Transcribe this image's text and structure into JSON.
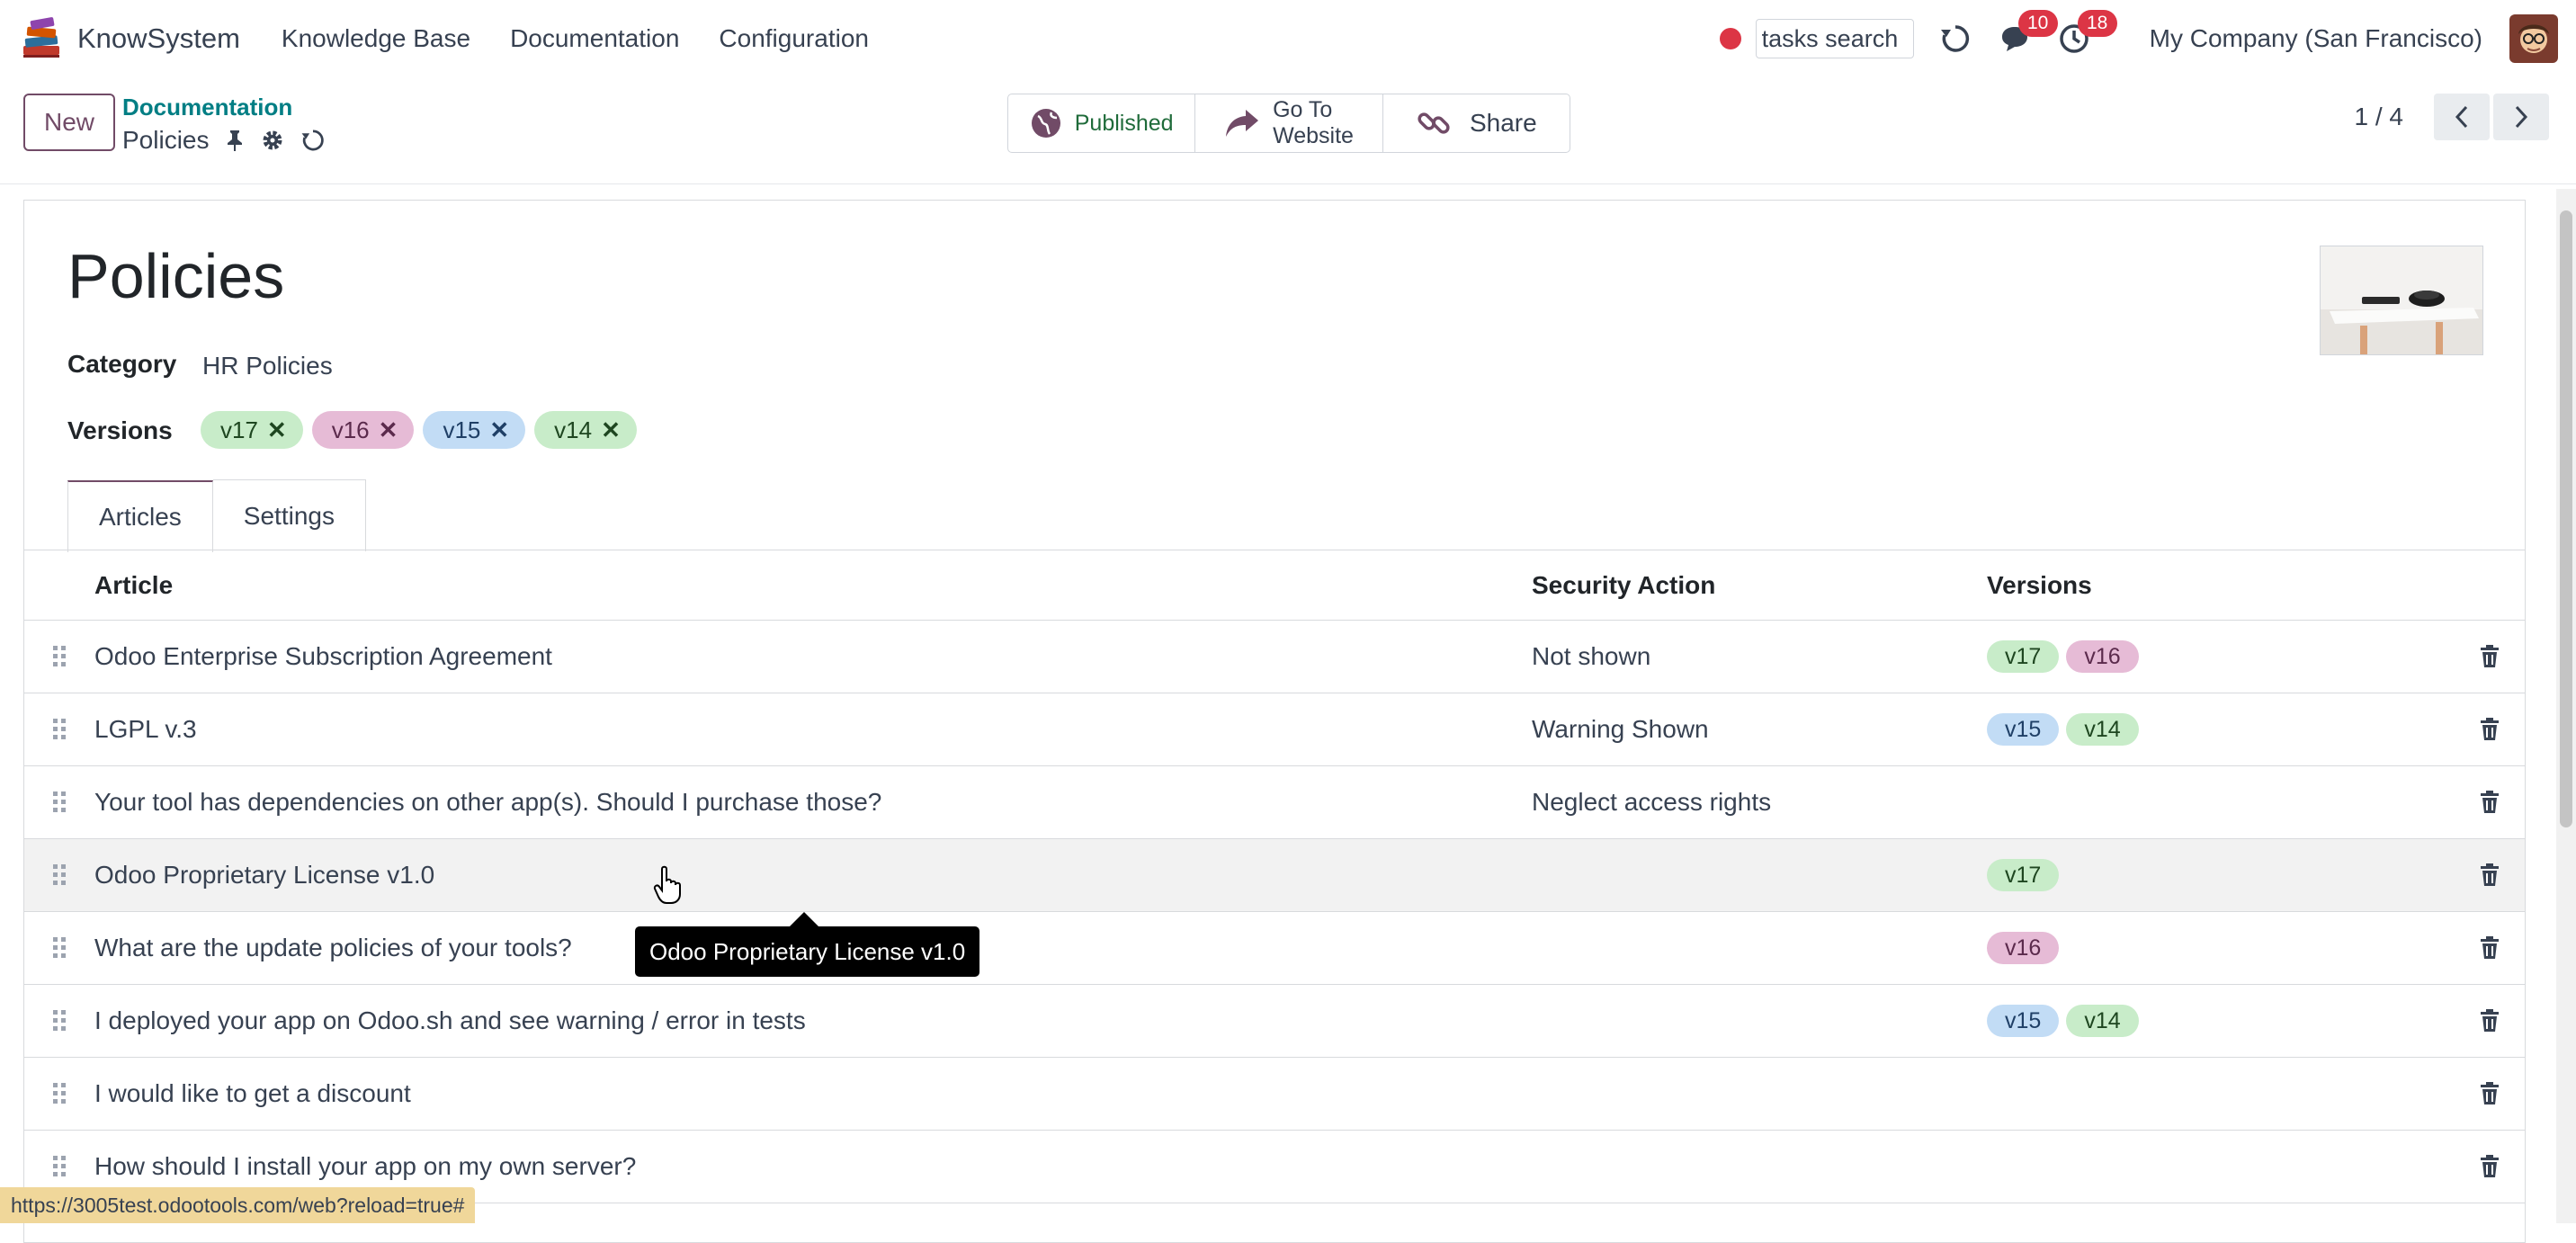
{
  "app": {
    "name": "KnowSystem"
  },
  "menu": [
    "Knowledge Base",
    "Documentation",
    "Configuration"
  ],
  "systray": {
    "search_placeholder": "tasks search",
    "messages_count": "10",
    "activities_count": "18",
    "company": "My Company (San Francisco)"
  },
  "control": {
    "new_label": "New",
    "breadcrumb_parent": "Documentation",
    "breadcrumb_current": "Policies",
    "published_label": "Published",
    "goto_line1": "Go To",
    "goto_line2": "Website",
    "share_label": "Share",
    "pager": "1 / 4"
  },
  "form": {
    "title": "Policies",
    "category_label": "Category",
    "category_value": "HR Policies",
    "versions_label": "Versions",
    "versions": [
      {
        "label": "v17",
        "color": "green"
      },
      {
        "label": "v16",
        "color": "purple"
      },
      {
        "label": "v15",
        "color": "blue"
      },
      {
        "label": "v14",
        "color": "green"
      }
    ],
    "tabs": [
      "Articles",
      "Settings"
    ]
  },
  "table": {
    "headers": {
      "article": "Article",
      "security": "Security Action",
      "versions": "Versions"
    },
    "rows": [
      {
        "article": "Odoo Enterprise Subscription Agreement",
        "security": "Not shown",
        "versions": [
          "v17",
          "v16"
        ]
      },
      {
        "article": "LGPL v.3",
        "security": "Warning Shown",
        "versions": [
          "v15",
          "v14"
        ]
      },
      {
        "article": "Your tool has dependencies on other app(s). Should I purchase those?",
        "security": "Neglect access rights",
        "versions": []
      },
      {
        "article": "Odoo Proprietary License v1.0",
        "security": "",
        "versions": [
          "v17"
        ]
      },
      {
        "article": "What are the update policies of your tools?",
        "security": "",
        "versions": [
          "v16"
        ]
      },
      {
        "article": "I deployed your app on Odoo.sh and see warning / error in tests",
        "security": "",
        "versions": [
          "v15",
          "v14"
        ]
      },
      {
        "article": "I would like to get a discount",
        "security": "",
        "versions": []
      },
      {
        "article": "How should I install your app on my own server?",
        "security": "",
        "versions": []
      }
    ]
  },
  "tooltip": "Odoo Proprietary License v1.0",
  "status_url": "https://3005test.odootools.com/web?reload=true#",
  "colors": {
    "brand": "#714B67",
    "link": "#017e84",
    "badge": "#dc3545",
    "tag_green": "#c8ecc9",
    "tag_purple": "#e6bbd6",
    "tag_blue": "#c2dcf5"
  }
}
